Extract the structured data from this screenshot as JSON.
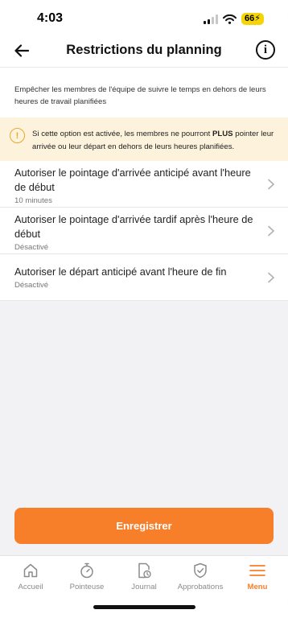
{
  "status": {
    "time": "4:03",
    "battery": "66"
  },
  "header": {
    "title": "Restrictions du planning"
  },
  "description": "Empêcher les membres de l'équipe de suivre le temps en dehors de leurs heures de travail planifiées",
  "warning": {
    "text_before": "Si cette option est activée, les membres ne pourront ",
    "emphasis": "PLUS",
    "text_after": " pointer leur arrivée ou leur départ en dehors de leurs heures planifiées."
  },
  "settings": [
    {
      "title": "Autoriser le pointage d'arrivée anticipé avant l'heure de début",
      "value": "10 minutes"
    },
    {
      "title": "Autoriser le pointage d'arrivée tardif après l'heure de début",
      "value": "Désactivé"
    },
    {
      "title": "Autoriser le départ anticipé avant l'heure de fin",
      "value": "Désactivé"
    }
  ],
  "save_label": "Enregistrer",
  "tabs": [
    {
      "label": "Accueil",
      "icon": "home-icon"
    },
    {
      "label": "Pointeuse",
      "icon": "stopwatch-icon"
    },
    {
      "label": "Journal",
      "icon": "journal-icon"
    },
    {
      "label": "Approbations",
      "icon": "shield-check-icon"
    },
    {
      "label": "Menu",
      "icon": "menu-icon",
      "active": true
    }
  ],
  "colors": {
    "accent": "#f77f2a",
    "warning_bg": "#fdf3dc",
    "warning_icon": "#e8a832",
    "battery": "#f5d50a"
  }
}
